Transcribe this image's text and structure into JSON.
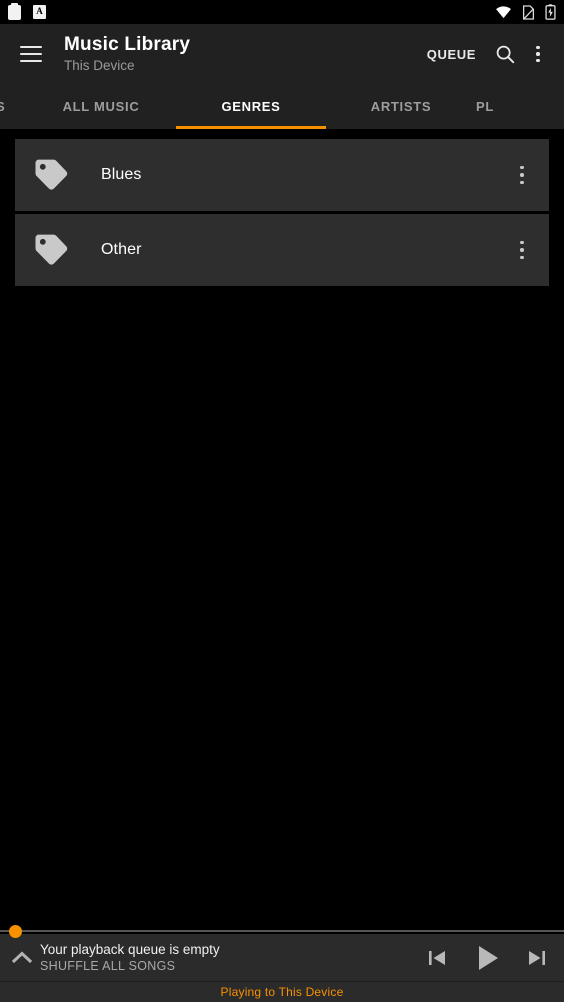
{
  "status_bar": {
    "left_icons": [
      "clipboard-icon",
      "a-box-icon"
    ],
    "a_box_letter": "A",
    "right_icons": [
      "wifi-icon",
      "no-sim-icon",
      "battery-charging-icon"
    ]
  },
  "app_bar": {
    "menu_icon": "hamburger-menu-icon",
    "title": "Music Library",
    "subtitle": "This Device",
    "queue_label": "QUEUE",
    "search_icon": "search-icon",
    "overflow_icon": "overflow-menu-icon"
  },
  "tabs": {
    "active_color": "#f79100",
    "items": [
      {
        "label": "S",
        "active": false,
        "clipped": "left"
      },
      {
        "label": "ALL MUSIC",
        "active": false
      },
      {
        "label": "GENRES",
        "active": true
      },
      {
        "label": "ARTISTS",
        "active": false
      },
      {
        "label": "PL",
        "active": false,
        "clipped": "right"
      }
    ]
  },
  "genre_list": {
    "rows": [
      {
        "label": "Blues",
        "icon": "tag-icon",
        "menu_icon": "overflow-menu-icon"
      },
      {
        "label": "Other",
        "icon": "tag-icon",
        "menu_icon": "overflow-menu-icon"
      }
    ]
  },
  "player": {
    "seek_position_percent": 0,
    "expand_icon": "chevron-up-icon",
    "title": "Your playback queue is empty",
    "subtitle": "SHUFFLE ALL SONGS",
    "controls": [
      {
        "name": "previous-track-button",
        "icon": "skip-previous-icon"
      },
      {
        "name": "play-button",
        "icon": "play-icon"
      },
      {
        "name": "next-track-button",
        "icon": "skip-next-icon"
      }
    ],
    "casting_status": "Playing to This Device",
    "casting_status_color": "#f79100"
  }
}
